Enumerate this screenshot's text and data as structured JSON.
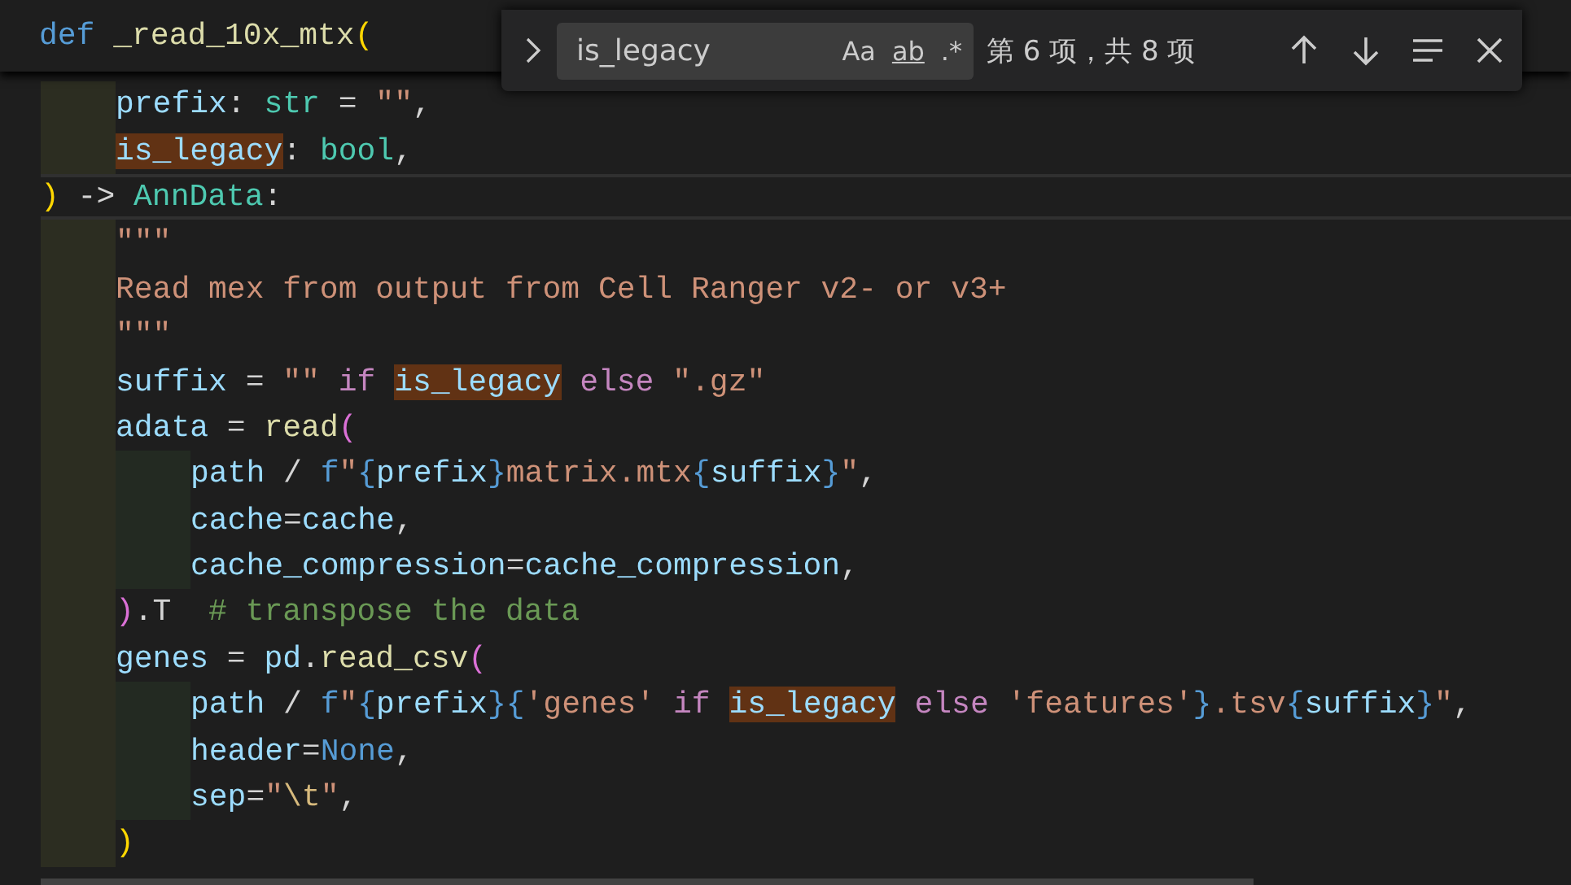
{
  "sticky_header": {
    "tokens": [
      {
        "kind": "kw",
        "text": "def "
      },
      {
        "kind": "fn",
        "text": "_read_10x_mtx"
      },
      {
        "kind": "bracket1",
        "text": "("
      }
    ],
    "children": [
      {
        "tokens": [
          {
            "kind": "param",
            "text": "prefix"
          },
          {
            "kind": "op",
            "text": ": "
          },
          {
            "kind": "type",
            "text": "str"
          },
          {
            "kind": "op",
            "text": " = "
          },
          {
            "kind": "str",
            "text": "\"\""
          },
          {
            "kind": "op",
            "text": ","
          }
        ]
      },
      {
        "tokens": [
          {
            "kind": "param",
            "text": "is_legacy",
            "match": true
          },
          {
            "kind": "op",
            "text": ": "
          },
          {
            "kind": "type",
            "text": "bool"
          },
          {
            "kind": "op",
            "text": ","
          }
        ]
      }
    ]
  },
  "code_lines": [
    {
      "tokens": [
        {
          "kind": "bracket1",
          "text": ")"
        },
        {
          "kind": "op",
          "text": " -> "
        },
        {
          "kind": "type",
          "text": "AnnData"
        },
        {
          "kind": "op",
          "text": ":"
        }
      ],
      "current": true,
      "children": [
        {
          "tokens": [
            {
              "kind": "str",
              "text": "\"\"\""
            }
          ]
        },
        {
          "tokens": [
            {
              "kind": "str",
              "text": "Read mex from output from Cell Ranger v2- or v3+"
            }
          ]
        },
        {
          "tokens": [
            {
              "kind": "str",
              "text": "\"\"\""
            }
          ]
        },
        {
          "tokens": [
            {
              "kind": "param",
              "text": "suffix"
            },
            {
              "kind": "op",
              "text": " = "
            },
            {
              "kind": "str",
              "text": "\"\""
            },
            {
              "kind": "ctl",
              "text": " if "
            },
            {
              "kind": "param",
              "text": "is_legacy",
              "match": true
            },
            {
              "kind": "ctl",
              "text": " else "
            },
            {
              "kind": "str",
              "text": "\".gz\""
            }
          ]
        },
        {
          "tokens": [
            {
              "kind": "param",
              "text": "adata"
            },
            {
              "kind": "op",
              "text": " = "
            },
            {
              "kind": "fn",
              "text": "read"
            },
            {
              "kind": "bracket2",
              "text": "("
            }
          ],
          "children": [
            {
              "tokens": [
                {
                  "kind": "param",
                  "text": "path"
                },
                {
                  "kind": "op",
                  "text": " / "
                },
                {
                  "kind": "kw",
                  "text": "f"
                },
                {
                  "kind": "str",
                  "text": "\""
                },
                {
                  "kind": "kw",
                  "text": "{"
                },
                {
                  "kind": "param",
                  "text": "prefix"
                },
                {
                  "kind": "kw",
                  "text": "}"
                },
                {
                  "kind": "str",
                  "text": "matrix.mtx"
                },
                {
                  "kind": "kw",
                  "text": "{"
                },
                {
                  "kind": "param",
                  "text": "suffix"
                },
                {
                  "kind": "kw",
                  "text": "}"
                },
                {
                  "kind": "str",
                  "text": "\""
                },
                {
                  "kind": "op",
                  "text": ","
                }
              ]
            },
            {
              "tokens": [
                {
                  "kind": "param",
                  "text": "cache"
                },
                {
                  "kind": "op",
                  "text": "="
                },
                {
                  "kind": "param",
                  "text": "cache"
                },
                {
                  "kind": "op",
                  "text": ","
                }
              ]
            },
            {
              "tokens": [
                {
                  "kind": "param",
                  "text": "cache_compression"
                },
                {
                  "kind": "op",
                  "text": "="
                },
                {
                  "kind": "param",
                  "text": "cache_compression"
                },
                {
                  "kind": "op",
                  "text": ","
                }
              ]
            }
          ]
        },
        {
          "tokens": [
            {
              "kind": "bracket2",
              "text": ")"
            },
            {
              "kind": "op",
              "text": ".T  "
            },
            {
              "kind": "comment",
              "text": "# transpose the data"
            }
          ]
        },
        {
          "tokens": [
            {
              "kind": "param",
              "text": "genes"
            },
            {
              "kind": "op",
              "text": " = "
            },
            {
              "kind": "param",
              "text": "pd"
            },
            {
              "kind": "op",
              "text": "."
            },
            {
              "kind": "fn",
              "text": "read_csv"
            },
            {
              "kind": "bracket2",
              "text": "("
            }
          ],
          "children": [
            {
              "tokens": [
                {
                  "kind": "param",
                  "text": "path"
                },
                {
                  "kind": "op",
                  "text": " / "
                },
                {
                  "kind": "kw",
                  "text": "f"
                },
                {
                  "kind": "str",
                  "text": "\""
                },
                {
                  "kind": "kw",
                  "text": "{"
                },
                {
                  "kind": "param",
                  "text": "prefix"
                },
                {
                  "kind": "kw",
                  "text": "}{"
                },
                {
                  "kind": "str",
                  "text": "'genes'"
                },
                {
                  "kind": "ctl",
                  "text": " if "
                },
                {
                  "kind": "param",
                  "text": "is_legacy",
                  "match": true
                },
                {
                  "kind": "ctl",
                  "text": " else "
                },
                {
                  "kind": "str",
                  "text": "'features'"
                },
                {
                  "kind": "kw",
                  "text": "}"
                },
                {
                  "kind": "str",
                  "text": ".tsv"
                },
                {
                  "kind": "kw",
                  "text": "{"
                },
                {
                  "kind": "param",
                  "text": "suffix"
                },
                {
                  "kind": "kw",
                  "text": "}"
                },
                {
                  "kind": "str",
                  "text": "\""
                },
                {
                  "kind": "op",
                  "text": ","
                }
              ]
            },
            {
              "tokens": [
                {
                  "kind": "param",
                  "text": "header"
                },
                {
                  "kind": "op",
                  "text": "="
                },
                {
                  "kind": "kw",
                  "text": "None"
                },
                {
                  "kind": "op",
                  "text": ","
                }
              ]
            },
            {
              "tokens": [
                {
                  "kind": "param",
                  "text": "sep"
                },
                {
                  "kind": "op",
                  "text": "="
                },
                {
                  "kind": "str",
                  "text": "\""
                },
                {
                  "kind": "esc",
                  "text": "\\t"
                },
                {
                  "kind": "str",
                  "text": "\""
                },
                {
                  "kind": "op",
                  "text": ","
                }
              ]
            }
          ]
        },
        {
          "tokens": [
            {
              "kind": "bracket1",
              "text": ")"
            }
          ]
        }
      ]
    }
  ],
  "find_widget": {
    "expanded": false,
    "query": "is_legacy",
    "options": [
      {
        "label": "Aa",
        "on": false
      },
      {
        "label": "ab",
        "on": false
      },
      {
        "label": ".*",
        "on": false
      }
    ],
    "count": "第 6 项，共 8 项"
  }
}
